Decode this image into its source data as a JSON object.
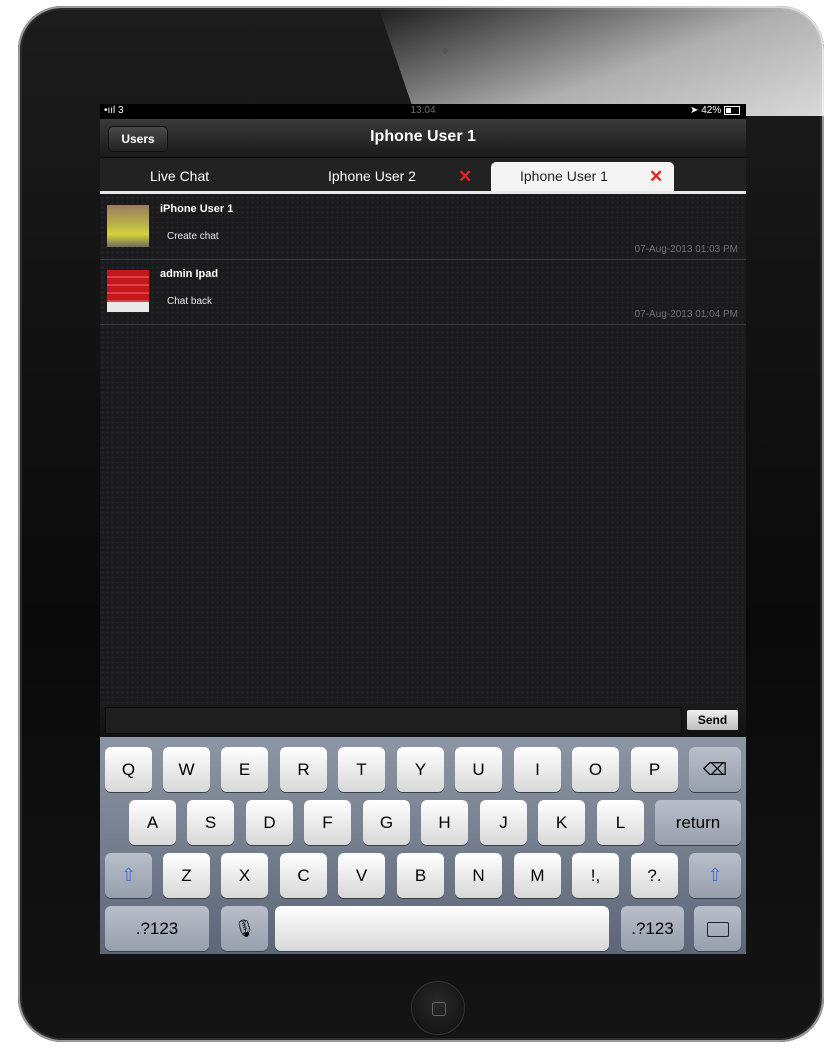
{
  "status_bar": {
    "signal": "•ııl 3",
    "time": "13:04",
    "battery": "42%"
  },
  "nav": {
    "users_label": "Users",
    "title": "Iphone User 1"
  },
  "tabs": [
    {
      "label": "Live Chat"
    },
    {
      "label": "Iphone User 2",
      "close": "✕"
    },
    {
      "label": "Iphone User 1",
      "close": "✕"
    }
  ],
  "messages": [
    {
      "sender": "iPhone User 1",
      "text": "Create chat",
      "time": "07-Aug-2013 01:03 PM"
    },
    {
      "sender": "admin Ipad",
      "text": "Chat back",
      "time": "07-Aug-2013 01:04 PM"
    }
  ],
  "compose": {
    "send_label": "Send"
  },
  "keyboard": {
    "row1": [
      "Q",
      "W",
      "E",
      "R",
      "T",
      "Y",
      "U",
      "I",
      "O",
      "P"
    ],
    "row2": [
      "A",
      "S",
      "D",
      "F",
      "G",
      "H",
      "J",
      "K",
      "L"
    ],
    "row3": [
      "Z",
      "X",
      "C",
      "V",
      "B",
      "N",
      "M",
      "!,",
      "?."
    ],
    "return_label": "return",
    "numbers_label": ".?123",
    "backspace": "⌫",
    "shift": "⇧",
    "mic": "🎙"
  }
}
